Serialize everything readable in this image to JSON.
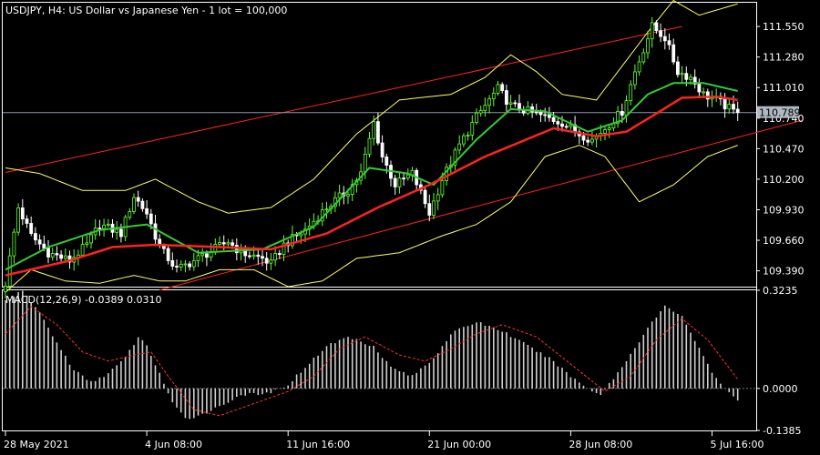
{
  "header": {
    "symbol_title": "USDJPY, H4:  US Dollar vs Japanese Yen - 1 lot = 100,000"
  },
  "colors": {
    "background": "#000000",
    "axis": "#ffffff",
    "bull_candle": "#66ff33",
    "bear_candle": "#ffffff",
    "bollinger": "#ffff66",
    "fast_ma": "#33cc33",
    "slow_ma": "#ff2222",
    "channel": "#ff2222",
    "macd_hist": "#d0d0d0",
    "macd_signal": "#ff3333",
    "price_line": "#8899aa"
  },
  "chart_data": [
    {
      "type": "candlestick",
      "title": "USDJPY, H4:  US Dollar vs Japanese Yen - 1 lot = 100,000",
      "ylim": [
        109.25,
        111.76
      ],
      "y_ticks": [
        "111.550",
        "111.280",
        "111.010",
        "110.740",
        "110.470",
        "110.200",
        "109.930",
        "109.660",
        "109.390"
      ],
      "current_price": "110.789",
      "x_ticks": [
        {
          "label": "28 May 2021",
          "bar": 0
        },
        {
          "label": "4 Jun 08:00",
          "bar": 33
        },
        {
          "label": "11 Jun 16:00",
          "bar": 66
        },
        {
          "label": "21 Jun 00:00",
          "bar": 99
        },
        {
          "label": "28 Jun 08:00",
          "bar": 132
        },
        {
          "label": "5 Jul 16:00",
          "bar": 165
        }
      ],
      "bars": 172,
      "close_anchors": [
        [
          0,
          109.28
        ],
        [
          3,
          109.95
        ],
        [
          6,
          109.7
        ],
        [
          10,
          109.55
        ],
        [
          15,
          109.48
        ],
        [
          19,
          109.62
        ],
        [
          22,
          109.8
        ],
        [
          27,
          109.72
        ],
        [
          30,
          110.05
        ],
        [
          33,
          109.9
        ],
        [
          36,
          109.6
        ],
        [
          40,
          109.4
        ],
        [
          45,
          109.5
        ],
        [
          52,
          109.65
        ],
        [
          55,
          109.55
        ],
        [
          60,
          109.5
        ],
        [
          62,
          109.45
        ],
        [
          65,
          109.62
        ],
        [
          70,
          109.75
        ],
        [
          75,
          109.95
        ],
        [
          80,
          110.1
        ],
        [
          83,
          110.25
        ],
        [
          86,
          110.7
        ],
        [
          88,
          110.4
        ],
        [
          91,
          110.15
        ],
        [
          95,
          110.25
        ],
        [
          99,
          109.9
        ],
        [
          102,
          110.2
        ],
        [
          106,
          110.5
        ],
        [
          110,
          110.75
        ],
        [
          115,
          111.0
        ],
        [
          118,
          110.85
        ],
        [
          122,
          110.8
        ],
        [
          126,
          110.75
        ],
        [
          130,
          110.7
        ],
        [
          134,
          110.6
        ],
        [
          137,
          110.55
        ],
        [
          140,
          110.65
        ],
        [
          144,
          110.8
        ],
        [
          147,
          111.15
        ],
        [
          151,
          111.55
        ],
        [
          154,
          111.45
        ],
        [
          157,
          111.15
        ],
        [
          160,
          111.1
        ],
        [
          163,
          110.95
        ],
        [
          166,
          110.9
        ],
        [
          170,
          110.8
        ],
        [
          171,
          110.79
        ]
      ],
      "slow_ma_anchors": [
        [
          0,
          109.35
        ],
        [
          15,
          109.48
        ],
        [
          25,
          109.6
        ],
        [
          35,
          109.62
        ],
        [
          50,
          109.6
        ],
        [
          62,
          109.58
        ],
        [
          75,
          109.72
        ],
        [
          87,
          109.95
        ],
        [
          99,
          110.15
        ],
        [
          112,
          110.4
        ],
        [
          128,
          110.65
        ],
        [
          138,
          110.58
        ],
        [
          145,
          110.62
        ],
        [
          152,
          110.78
        ],
        [
          158,
          110.92
        ],
        [
          166,
          110.93
        ],
        [
          171,
          110.9
        ]
      ],
      "fast_ma_anchors": [
        [
          0,
          109.4
        ],
        [
          10,
          109.6
        ],
        [
          22,
          109.75
        ],
        [
          33,
          109.8
        ],
        [
          45,
          109.55
        ],
        [
          60,
          109.58
        ],
        [
          72,
          109.78
        ],
        [
          85,
          110.3
        ],
        [
          94,
          110.25
        ],
        [
          100,
          110.15
        ],
        [
          110,
          110.55
        ],
        [
          118,
          110.82
        ],
        [
          126,
          110.8
        ],
        [
          136,
          110.62
        ],
        [
          144,
          110.72
        ],
        [
          150,
          110.95
        ],
        [
          156,
          111.05
        ],
        [
          163,
          111.05
        ],
        [
          171,
          110.98
        ]
      ],
      "bollinger_upper_anchors": [
        [
          0,
          110.3
        ],
        [
          8,
          110.25
        ],
        [
          18,
          110.1
        ],
        [
          28,
          110.1
        ],
        [
          35,
          110.2
        ],
        [
          45,
          110.0
        ],
        [
          52,
          109.9
        ],
        [
          62,
          109.95
        ],
        [
          72,
          110.2
        ],
        [
          82,
          110.6
        ],
        [
          92,
          110.9
        ],
        [
          104,
          110.95
        ],
        [
          112,
          111.1
        ],
        [
          118,
          111.3
        ],
        [
          124,
          111.15
        ],
        [
          130,
          110.95
        ],
        [
          138,
          110.9
        ],
        [
          144,
          111.2
        ],
        [
          150,
          111.5
        ],
        [
          156,
          111.78
        ],
        [
          162,
          111.65
        ],
        [
          171,
          111.75
        ]
      ],
      "bollinger_lower_anchors": [
        [
          0,
          109.2
        ],
        [
          6,
          109.4
        ],
        [
          14,
          109.3
        ],
        [
          22,
          109.28
        ],
        [
          30,
          109.35
        ],
        [
          36,
          109.3
        ],
        [
          42,
          109.3
        ],
        [
          50,
          109.4
        ],
        [
          58,
          109.4
        ],
        [
          66,
          109.25
        ],
        [
          74,
          109.3
        ],
        [
          82,
          109.5
        ],
        [
          92,
          109.55
        ],
        [
          102,
          109.7
        ],
        [
          110,
          109.8
        ],
        [
          118,
          110.0
        ],
        [
          126,
          110.4
        ],
        [
          134,
          110.5
        ],
        [
          140,
          110.4
        ],
        [
          148,
          110.0
        ],
        [
          156,
          110.15
        ],
        [
          164,
          110.4
        ],
        [
          171,
          110.5
        ]
      ],
      "channel_lines": [
        {
          "bar_start": 0,
          "price_start": 110.26,
          "bar_end": 158,
          "price_end": 111.55
        },
        {
          "bar_start": 36,
          "price_start": 109.22,
          "bar_end": 186,
          "price_end": 110.72
        }
      ]
    },
    {
      "type": "bar",
      "title": "MACD(12,26,9) -0.0389 0.0310",
      "ylim": [
        -0.1385,
        0.3235
      ],
      "y_ticks": [
        "0.3235",
        "0.0000",
        "-0.1385"
      ],
      "macd_anchors": [
        [
          0,
          0.29
        ],
        [
          4,
          0.32
        ],
        [
          8,
          0.25
        ],
        [
          12,
          0.15
        ],
        [
          16,
          0.06
        ],
        [
          20,
          0.02
        ],
        [
          24,
          0.05
        ],
        [
          28,
          0.1
        ],
        [
          31,
          0.17
        ],
        [
          33,
          0.14
        ],
        [
          36,
          0.05
        ],
        [
          39,
          -0.05
        ],
        [
          42,
          -0.1
        ],
        [
          45,
          -0.09
        ],
        [
          50,
          -0.06
        ],
        [
          55,
          -0.02
        ],
        [
          60,
          -0.02
        ],
        [
          65,
          0.0
        ],
        [
          70,
          0.07
        ],
        [
          75,
          0.14
        ],
        [
          80,
          0.17
        ],
        [
          86,
          0.14
        ],
        [
          90,
          0.07
        ],
        [
          95,
          0.04
        ],
        [
          100,
          0.1
        ],
        [
          104,
          0.18
        ],
        [
          110,
          0.22
        ],
        [
          116,
          0.19
        ],
        [
          122,
          0.14
        ],
        [
          128,
          0.09
        ],
        [
          132,
          0.04
        ],
        [
          136,
          0.0
        ],
        [
          139,
          -0.02
        ],
        [
          144,
          0.07
        ],
        [
          150,
          0.2
        ],
        [
          154,
          0.27
        ],
        [
          158,
          0.24
        ],
        [
          162,
          0.13
        ],
        [
          166,
          0.03
        ],
        [
          170,
          -0.03
        ],
        [
          171,
          -0.04
        ]
      ],
      "signal_anchors": [
        [
          0,
          0.18
        ],
        [
          6,
          0.27
        ],
        [
          12,
          0.21
        ],
        [
          18,
          0.12
        ],
        [
          24,
          0.09
        ],
        [
          30,
          0.11
        ],
        [
          34,
          0.12
        ],
        [
          38,
          0.04
        ],
        [
          44,
          -0.07
        ],
        [
          50,
          -0.09
        ],
        [
          58,
          -0.05
        ],
        [
          66,
          -0.01
        ],
        [
          72,
          0.04
        ],
        [
          78,
          0.13
        ],
        [
          84,
          0.17
        ],
        [
          92,
          0.11
        ],
        [
          98,
          0.09
        ],
        [
          104,
          0.13
        ],
        [
          110,
          0.18
        ],
        [
          116,
          0.21
        ],
        [
          124,
          0.17
        ],
        [
          132,
          0.08
        ],
        [
          140,
          -0.01
        ],
        [
          146,
          0.04
        ],
        [
          152,
          0.16
        ],
        [
          158,
          0.23
        ],
        [
          164,
          0.16
        ],
        [
          171,
          0.03
        ]
      ]
    }
  ]
}
